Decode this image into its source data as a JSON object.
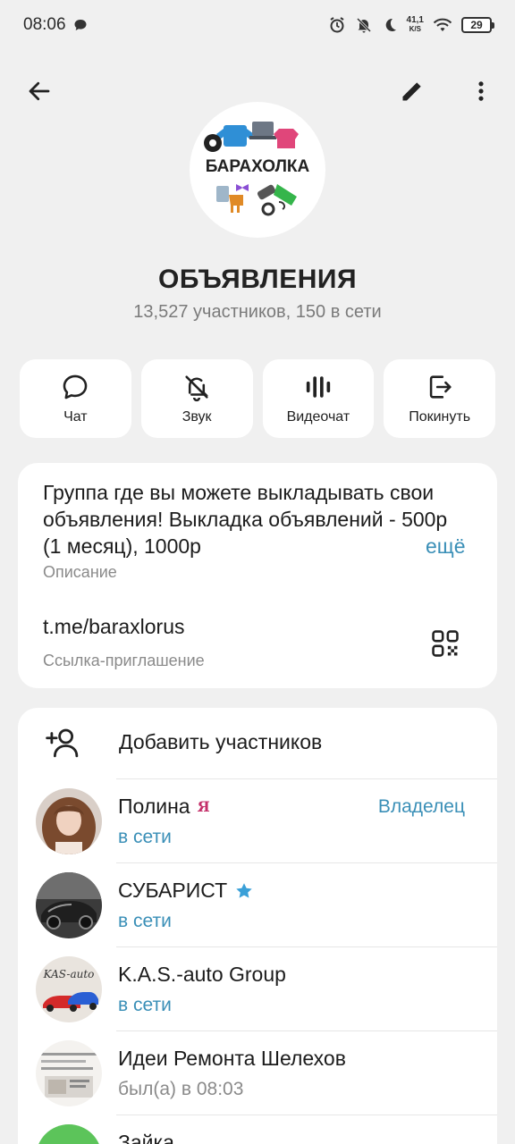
{
  "status_bar": {
    "time": "08:06",
    "net_speed_value": "41,1",
    "net_speed_unit": "K/S",
    "battery": "29"
  },
  "group": {
    "logo_text": "БАРАХОЛКА",
    "title": "ОБЪЯВЛЕНИЯ",
    "subtitle": "13,527 участников, 150 в сети"
  },
  "actions": [
    {
      "label": "Чат",
      "icon": "chat-bubble-icon"
    },
    {
      "label": "Звук",
      "icon": "bell-off-icon"
    },
    {
      "label": "Видеочат",
      "icon": "voice-wave-icon"
    },
    {
      "label": "Покинуть",
      "icon": "leave-icon"
    }
  ],
  "info": {
    "description": "Группа где вы можете выкладывать свои объявления! Выкладка объявлений - 500р (1 месяц), 1000р",
    "more_label": "ещё",
    "description_caption": "Описание",
    "invite_link": "t.me/baraxlorus",
    "invite_caption": "Ссылка-приглашение"
  },
  "members": {
    "add_label": "Добавить участников",
    "list": [
      {
        "name": "Полина",
        "status": "в сети",
        "role": "Владелец",
        "emoji_badge": "Я"
      },
      {
        "name": "СУБАРИСТ",
        "status": "в сети",
        "badge": "star"
      },
      {
        "name": "K.A.S.-auto Group",
        "status": "в сети",
        "avatar_text": "KAS-auto"
      },
      {
        "name": "Идеи Ремонта Шелехов",
        "status": "был(а) в 08:03"
      },
      {
        "name": "Зайка",
        "status": ""
      }
    ]
  },
  "colors": {
    "accent": "#3a8fb7",
    "background": "#f0f0f0",
    "card": "#ffffff"
  }
}
